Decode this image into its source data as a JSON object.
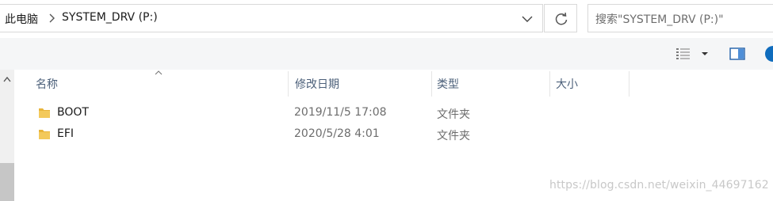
{
  "address_bar": {
    "segments": [
      "此电脑",
      "SYSTEM_DRV (P:)"
    ]
  },
  "search": {
    "placeholder": "搜索\"SYSTEM_DRV (P:)\""
  },
  "columns": {
    "name": "名称",
    "modified": "修改日期",
    "type": "类型",
    "size": "大小"
  },
  "files": [
    {
      "name": "BOOT",
      "modified": "2019/11/5 17:08",
      "type": "文件夹",
      "size": ""
    },
    {
      "name": "EFI",
      "modified": "2020/5/28 4:01",
      "type": "文件夹",
      "size": ""
    }
  ],
  "icons": {
    "folder": "folder-icon",
    "refresh": "refresh-icon",
    "dropdown": "chevron-down-icon",
    "details_view": "details-view-icon",
    "preview_pane": "preview-pane-icon",
    "help": "help-icon"
  },
  "colors": {
    "folder": "#e8b43a",
    "header_text": "#4c607a",
    "help_accent": "#0f6cbd"
  },
  "watermark": "https://blog.csdn.net/weixin_44697162"
}
